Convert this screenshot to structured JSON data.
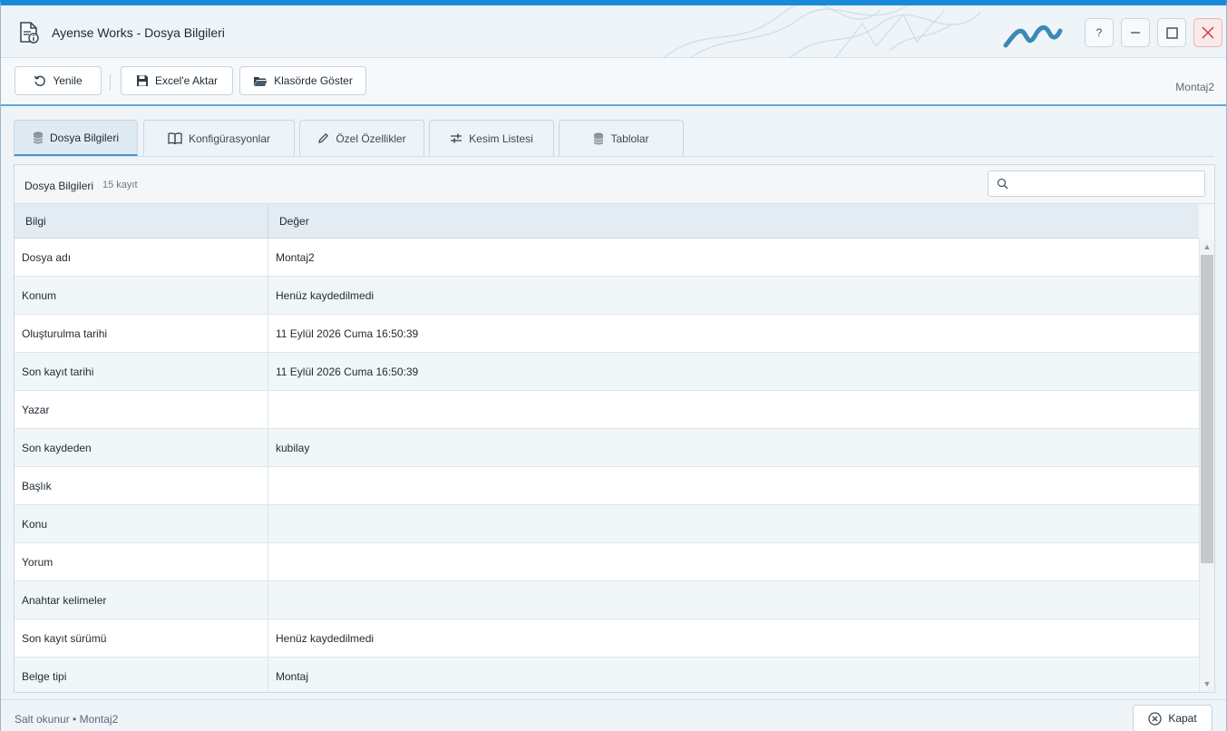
{
  "window": {
    "title": "Ayense Works - Dosya Bilgileri",
    "controls": {
      "help": "?",
      "minimize": "minimize-icon",
      "maximize": "maximize-icon",
      "close": "close-icon"
    }
  },
  "toolbar": {
    "refresh_label": "Yenile",
    "export_label": "Excel'e Aktar",
    "show_folder_label": "Klasörde Göster",
    "document_name": "Montaj2"
  },
  "tabs": [
    {
      "label": "Dosya Bilgileri",
      "icon": "database-icon",
      "active": true
    },
    {
      "label": "Konfigürasyonlar",
      "icon": "book-icon",
      "active": false
    },
    {
      "label": "Özel Özellikler",
      "icon": "pencil-icon",
      "active": false
    },
    {
      "label": "Kesim Listesi",
      "icon": "sliders-icon",
      "active": false
    },
    {
      "label": "Tablolar",
      "icon": "database-icon",
      "active": false
    }
  ],
  "panel": {
    "title": "Dosya Bilgileri",
    "count": "15 kayıt",
    "search": {
      "value": "",
      "placeholder": ""
    }
  },
  "grid": {
    "columns": [
      "Bilgi",
      "Değer"
    ],
    "rows": [
      {
        "key": "Dosya adı",
        "value": "Montaj2"
      },
      {
        "key": "Konum",
        "value": "Henüz kaydedilmedi"
      },
      {
        "key": "Oluşturulma tarihi",
        "value": "11 Eylül 2026 Cuma 16:50:39"
      },
      {
        "key": "Son kayıt tarihi",
        "value": "11 Eylül 2026 Cuma 16:50:39"
      },
      {
        "key": "Yazar",
        "value": ""
      },
      {
        "key": "Son kaydeden",
        "value": "kubilay"
      },
      {
        "key": "Başlık",
        "value": ""
      },
      {
        "key": "Konu",
        "value": ""
      },
      {
        "key": "Yorum",
        "value": ""
      },
      {
        "key": "Anahtar kelimeler",
        "value": ""
      },
      {
        "key": "Son kayıt sürümü",
        "value": "Henüz kaydedilmedi"
      },
      {
        "key": "Belge tipi",
        "value": "Montaj"
      }
    ]
  },
  "status": {
    "text": "Salt okunur • Montaj2",
    "close_label": "Kapat"
  },
  "colors": {
    "accent": "#1a8ad8",
    "close_bg": "#fbe9e9",
    "logo": "#3a8ab5"
  }
}
